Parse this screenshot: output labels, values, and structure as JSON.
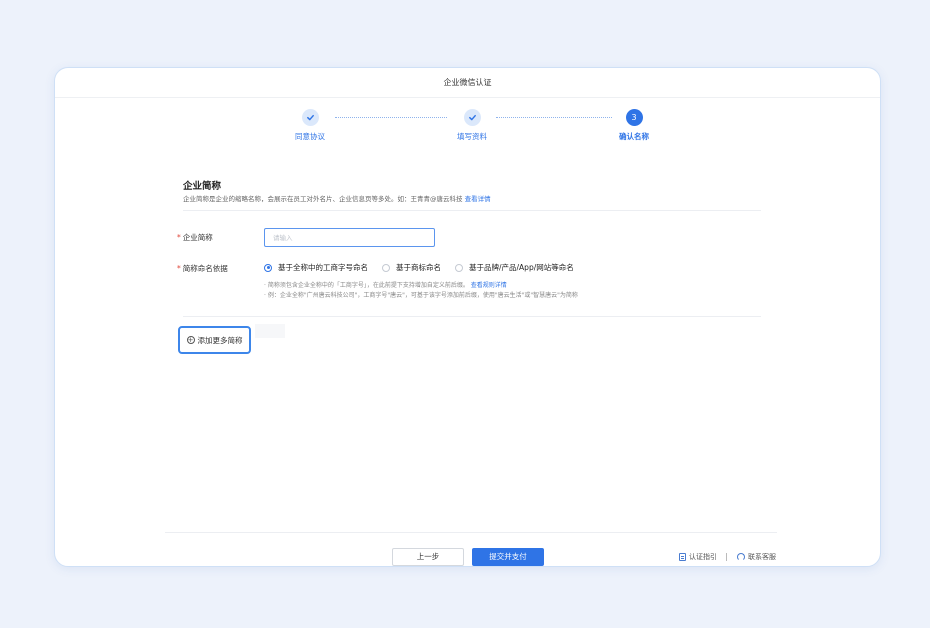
{
  "window": {
    "title": "企业微信认证"
  },
  "steps": [
    {
      "label": "同意协议",
      "status": "done",
      "number": ""
    },
    {
      "label": "填写资料",
      "status": "done",
      "number": ""
    },
    {
      "label": "确认名称",
      "status": "active",
      "number": "3"
    }
  ],
  "section": {
    "title": "企业简称",
    "description": "企业简称是企业的缩略名称，会展示在员工对外名片、企业信息页等多处。如：王青青@唐云科技",
    "description_link": "查看详情"
  },
  "form": {
    "name_label": "企业简称",
    "name_placeholder": "请输入",
    "basis_label": "简称命名依据",
    "options": [
      {
        "label": "基于全称中的工商字号命名",
        "checked": true
      },
      {
        "label": "基于商标命名",
        "checked": false
      },
      {
        "label": "基于品牌/产品/App/网站等命名",
        "checked": false
      }
    ],
    "hint1": "· 简称须包含企业全称中的「工商字号」，在此前提下支持增加自定义前后缀。",
    "hint1_link": "查看规则详情",
    "hint2": "· 例：企业全称\"广州唐云科技公司\"，工商字号\"唐云\"，可基于该字号添加前后缀，使用\"唐云生活\"或\"智慧唐云\"为简称"
  },
  "add_more_label": "添加更多简称",
  "footer": {
    "prev_label": "上一步",
    "submit_label": "提交并支付",
    "guide_label": "认证指引",
    "support_label": "联系客服"
  },
  "colors": {
    "accent": "#2f74e6",
    "required": "#e0463a"
  }
}
